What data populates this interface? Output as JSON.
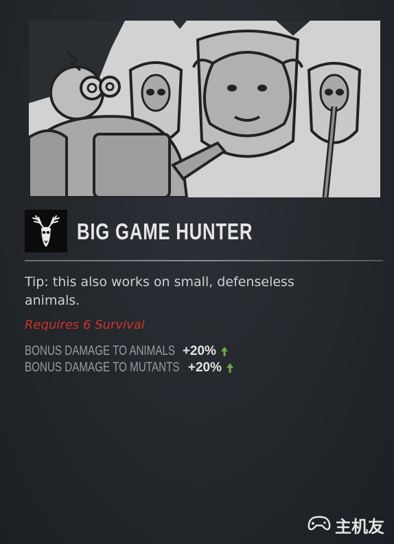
{
  "perk": {
    "title": "BIG GAME HUNTER",
    "icon": "deer-skull-icon",
    "tip": "Tip: this also works on small, defenseless animals.",
    "requirement": "Requires 6 Survival",
    "bonuses": [
      {
        "label": "BONUS DAMAGE TO ANIMALS",
        "value": "+20%",
        "trend_icon": "arrow-up-icon"
      },
      {
        "label": "BONUS DAMAGE TO MUTANTS",
        "value": "+20%",
        "trend_icon": "arrow-up-icon"
      }
    ]
  },
  "watermark": {
    "text": "主机友"
  },
  "colors": {
    "requirement": "#d0322c",
    "bonus_arrow": "#6ea84a",
    "title": "#e6e6e6",
    "background": "#25282d",
    "art_background": "#d2d2d2"
  }
}
